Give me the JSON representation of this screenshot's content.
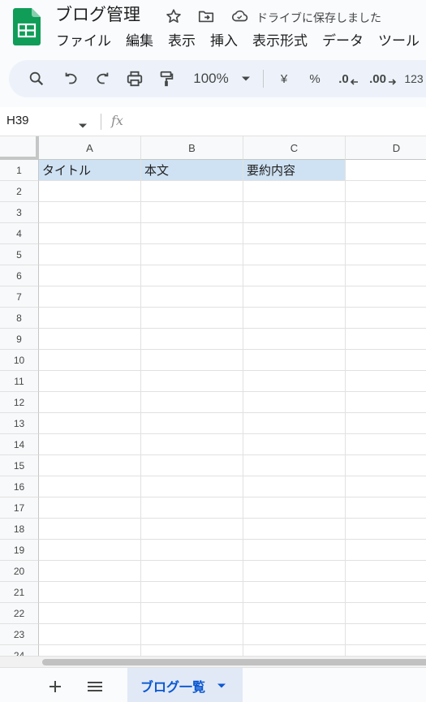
{
  "doc": {
    "title": "ブログ管理",
    "save_status": "ドライブに保存しました"
  },
  "menu": [
    "ファイル",
    "編集",
    "表示",
    "挿入",
    "表示形式",
    "データ",
    "ツール"
  ],
  "toolbar": {
    "zoom": "100%",
    "currency": "¥",
    "percent": "%",
    "decrease_decimal": ".0",
    "increase_decimal": ".00",
    "number_format": "123"
  },
  "formula_bar": {
    "cell_ref": "H39",
    "fx": "fx"
  },
  "sheet": {
    "columns": [
      "A",
      "B",
      "C",
      "D"
    ],
    "rows": [
      "1",
      "2",
      "3",
      "4",
      "5",
      "6",
      "7",
      "8",
      "9",
      "10",
      "11",
      "12",
      "13",
      "14",
      "15",
      "16",
      "17",
      "18",
      "19",
      "20",
      "21",
      "22",
      "23",
      "24"
    ],
    "header_row": [
      "タイトル",
      "本文",
      "要約内容",
      ""
    ]
  },
  "sheets_bar": {
    "active_tab": "ブログ一覧"
  },
  "colors": {
    "header_fill": "#cfe2f3",
    "accent": "#0b57d0",
    "logo_green": "#0f9d58"
  }
}
